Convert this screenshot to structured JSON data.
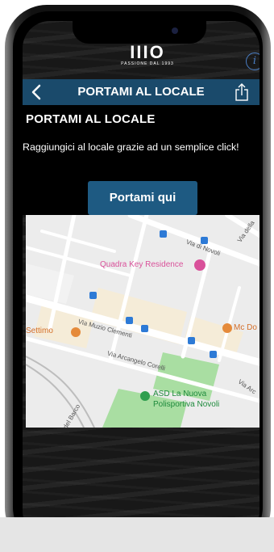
{
  "header": {
    "logo_mark": "ΙΙΙΟ",
    "logo_sub": "PASSIONE DAL 1993",
    "info_icon": "info-icon"
  },
  "navbar": {
    "back_icon": "chevron-left-icon",
    "title": "PORTAMI AL LOCALE",
    "share_icon": "share-icon"
  },
  "content": {
    "section_title": "PORTAMI AL LOCALE",
    "description": "Raggiungici al locale grazie ad un semplice click!",
    "cta_label": "Portami qui"
  },
  "map": {
    "labels": {
      "poi_hotel": "Quadra Key Residence",
      "poi_left": "Settimo",
      "poi_right": "Mc Do",
      "poi_sport_line1": "ASD La Nuova",
      "poi_sport_line2": "Polisportiva Novoli",
      "street_novoli": "Via di Novoli",
      "street_della": "Via della",
      "street_muzio": "Via Muzio Clementi",
      "street_arcangelo": "Via Arcangelo Corelli",
      "street_arc_short": "Via Arc",
      "street_barco": "del Barco"
    },
    "colors": {
      "land": "#ececec",
      "road": "#ffffff",
      "block": "#f5ecd8",
      "park": "#a9dea2",
      "rail": "#bdbdbd",
      "poi_pink": "#d9519a",
      "poi_orange": "#e58a3a",
      "poi_green": "#2f9e4f",
      "transit": "#2d7ad6"
    }
  },
  "colors": {
    "navbar_bg": "#1a4a6b",
    "cta_bg": "#1e5a82",
    "text": "#ffffff"
  }
}
